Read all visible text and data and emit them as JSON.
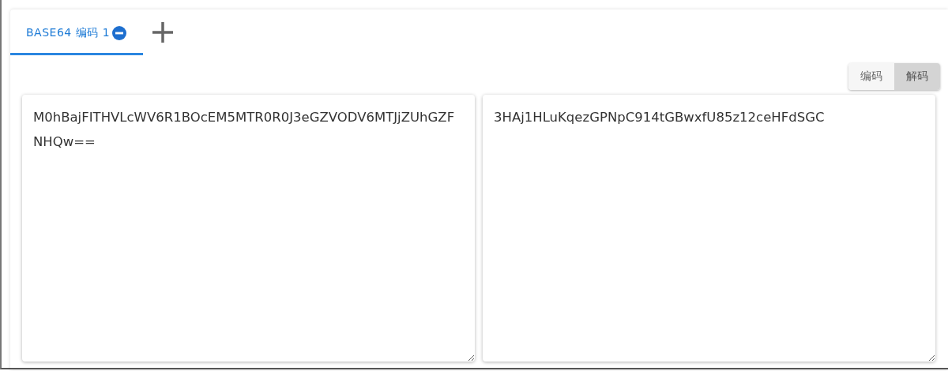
{
  "tabs": [
    {
      "label": "BASE64 编码 1",
      "selected": true
    }
  ],
  "mode_buttons": [
    {
      "label": "编码",
      "selected": false
    },
    {
      "label": "解码",
      "selected": true
    }
  ],
  "panels": [
    {
      "value": "M0hBajFITHVLcWV6R1BOcEM5MTR0R0J3eGZVODV6MTJjZUhGZFNHQw=="
    },
    {
      "value": "3HAj1HLuKqezGPNpC914tGBwxfU85z12ceHFdSGC"
    }
  ]
}
